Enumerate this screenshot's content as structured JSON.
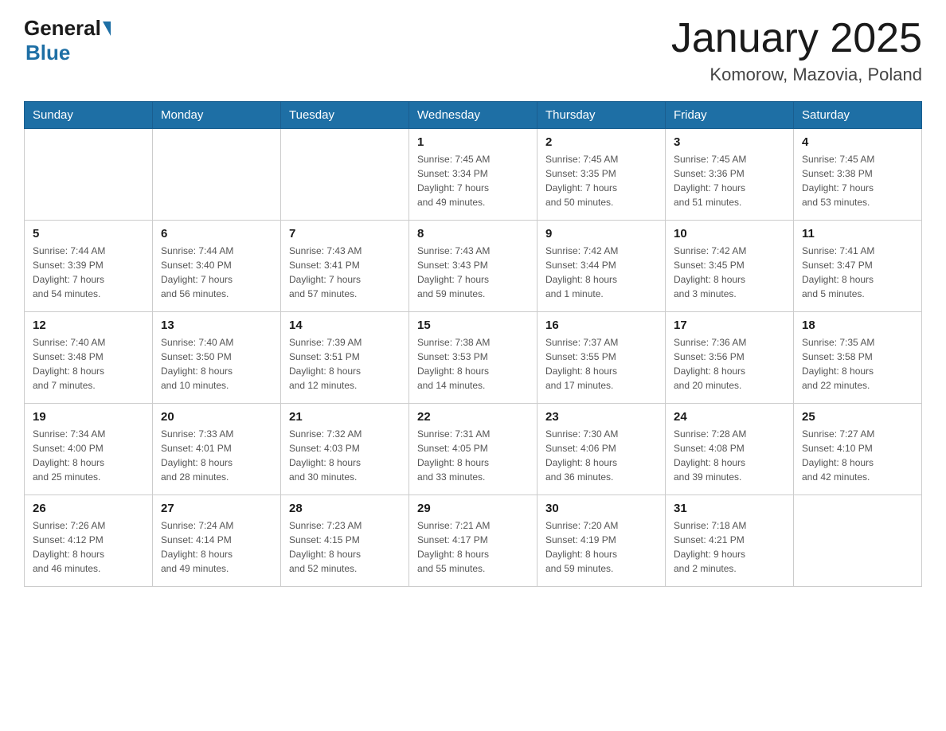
{
  "header": {
    "logo_general": "General",
    "logo_blue": "Blue",
    "title": "January 2025",
    "subtitle": "Komorow, Mazovia, Poland"
  },
  "weekdays": [
    "Sunday",
    "Monday",
    "Tuesday",
    "Wednesday",
    "Thursday",
    "Friday",
    "Saturday"
  ],
  "weeks": [
    [
      {
        "day": "",
        "info": ""
      },
      {
        "day": "",
        "info": ""
      },
      {
        "day": "",
        "info": ""
      },
      {
        "day": "1",
        "info": "Sunrise: 7:45 AM\nSunset: 3:34 PM\nDaylight: 7 hours\nand 49 minutes."
      },
      {
        "day": "2",
        "info": "Sunrise: 7:45 AM\nSunset: 3:35 PM\nDaylight: 7 hours\nand 50 minutes."
      },
      {
        "day": "3",
        "info": "Sunrise: 7:45 AM\nSunset: 3:36 PM\nDaylight: 7 hours\nand 51 minutes."
      },
      {
        "day": "4",
        "info": "Sunrise: 7:45 AM\nSunset: 3:38 PM\nDaylight: 7 hours\nand 53 minutes."
      }
    ],
    [
      {
        "day": "5",
        "info": "Sunrise: 7:44 AM\nSunset: 3:39 PM\nDaylight: 7 hours\nand 54 minutes."
      },
      {
        "day": "6",
        "info": "Sunrise: 7:44 AM\nSunset: 3:40 PM\nDaylight: 7 hours\nand 56 minutes."
      },
      {
        "day": "7",
        "info": "Sunrise: 7:43 AM\nSunset: 3:41 PM\nDaylight: 7 hours\nand 57 minutes."
      },
      {
        "day": "8",
        "info": "Sunrise: 7:43 AM\nSunset: 3:43 PM\nDaylight: 7 hours\nand 59 minutes."
      },
      {
        "day": "9",
        "info": "Sunrise: 7:42 AM\nSunset: 3:44 PM\nDaylight: 8 hours\nand 1 minute."
      },
      {
        "day": "10",
        "info": "Sunrise: 7:42 AM\nSunset: 3:45 PM\nDaylight: 8 hours\nand 3 minutes."
      },
      {
        "day": "11",
        "info": "Sunrise: 7:41 AM\nSunset: 3:47 PM\nDaylight: 8 hours\nand 5 minutes."
      }
    ],
    [
      {
        "day": "12",
        "info": "Sunrise: 7:40 AM\nSunset: 3:48 PM\nDaylight: 8 hours\nand 7 minutes."
      },
      {
        "day": "13",
        "info": "Sunrise: 7:40 AM\nSunset: 3:50 PM\nDaylight: 8 hours\nand 10 minutes."
      },
      {
        "day": "14",
        "info": "Sunrise: 7:39 AM\nSunset: 3:51 PM\nDaylight: 8 hours\nand 12 minutes."
      },
      {
        "day": "15",
        "info": "Sunrise: 7:38 AM\nSunset: 3:53 PM\nDaylight: 8 hours\nand 14 minutes."
      },
      {
        "day": "16",
        "info": "Sunrise: 7:37 AM\nSunset: 3:55 PM\nDaylight: 8 hours\nand 17 minutes."
      },
      {
        "day": "17",
        "info": "Sunrise: 7:36 AM\nSunset: 3:56 PM\nDaylight: 8 hours\nand 20 minutes."
      },
      {
        "day": "18",
        "info": "Sunrise: 7:35 AM\nSunset: 3:58 PM\nDaylight: 8 hours\nand 22 minutes."
      }
    ],
    [
      {
        "day": "19",
        "info": "Sunrise: 7:34 AM\nSunset: 4:00 PM\nDaylight: 8 hours\nand 25 minutes."
      },
      {
        "day": "20",
        "info": "Sunrise: 7:33 AM\nSunset: 4:01 PM\nDaylight: 8 hours\nand 28 minutes."
      },
      {
        "day": "21",
        "info": "Sunrise: 7:32 AM\nSunset: 4:03 PM\nDaylight: 8 hours\nand 30 minutes."
      },
      {
        "day": "22",
        "info": "Sunrise: 7:31 AM\nSunset: 4:05 PM\nDaylight: 8 hours\nand 33 minutes."
      },
      {
        "day": "23",
        "info": "Sunrise: 7:30 AM\nSunset: 4:06 PM\nDaylight: 8 hours\nand 36 minutes."
      },
      {
        "day": "24",
        "info": "Sunrise: 7:28 AM\nSunset: 4:08 PM\nDaylight: 8 hours\nand 39 minutes."
      },
      {
        "day": "25",
        "info": "Sunrise: 7:27 AM\nSunset: 4:10 PM\nDaylight: 8 hours\nand 42 minutes."
      }
    ],
    [
      {
        "day": "26",
        "info": "Sunrise: 7:26 AM\nSunset: 4:12 PM\nDaylight: 8 hours\nand 46 minutes."
      },
      {
        "day": "27",
        "info": "Sunrise: 7:24 AM\nSunset: 4:14 PM\nDaylight: 8 hours\nand 49 minutes."
      },
      {
        "day": "28",
        "info": "Sunrise: 7:23 AM\nSunset: 4:15 PM\nDaylight: 8 hours\nand 52 minutes."
      },
      {
        "day": "29",
        "info": "Sunrise: 7:21 AM\nSunset: 4:17 PM\nDaylight: 8 hours\nand 55 minutes."
      },
      {
        "day": "30",
        "info": "Sunrise: 7:20 AM\nSunset: 4:19 PM\nDaylight: 8 hours\nand 59 minutes."
      },
      {
        "day": "31",
        "info": "Sunrise: 7:18 AM\nSunset: 4:21 PM\nDaylight: 9 hours\nand 2 minutes."
      },
      {
        "day": "",
        "info": ""
      }
    ]
  ]
}
